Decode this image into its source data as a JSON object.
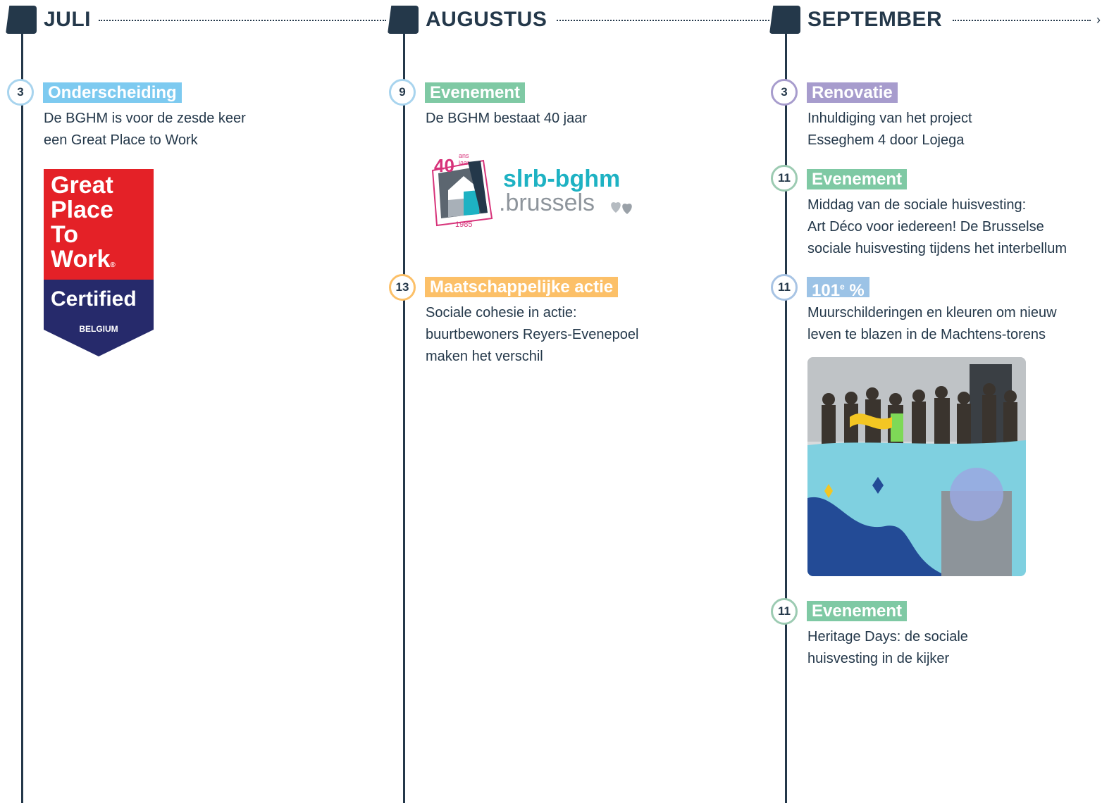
{
  "months": [
    {
      "name": "JULI",
      "events": [
        {
          "day": "3",
          "tag": "Onderscheiding",
          "lines": [
            "De BGHM is voor de zesde keer",
            "een Great Place to Work"
          ]
        }
      ],
      "badge": {
        "line1": "Great",
        "line2": "Place",
        "line3": "To",
        "line4": "Work",
        "reg": "®",
        "certified": "Certified",
        "country": "BELGIUM"
      }
    },
    {
      "name": "AUGUSTUS",
      "events": [
        {
          "day": "9",
          "tag": "Evenement",
          "lines": [
            "De BGHM bestaat 40 jaar"
          ]
        },
        {
          "day": "13",
          "tag": "Maatschappelijke actie",
          "lines": [
            "Sociale cohesie in actie:",
            "buurtbewoners Reyers-Evenepoel",
            "maken het verschil"
          ]
        }
      ],
      "logo": {
        "number": "40",
        "small_top": "ans",
        "small_bottom": "jaar",
        "year": "1985",
        "name_top": "slrb-bghm",
        "name_bottom": ".brussels"
      }
    },
    {
      "name": "SEPTEMBER",
      "events": [
        {
          "day": "3",
          "tag": "Renovatie",
          "lines": [
            "Inhuldiging van het project",
            "Esseghem 4 door Lojega"
          ]
        },
        {
          "day": "11",
          "tag": "Evenement",
          "lines": [
            "Middag van de sociale huisvesting:",
            "Art Déco voor iedereen! De Brusselse",
            "sociale huisvesting tijdens het interbellum"
          ]
        },
        {
          "day": "11",
          "tag_main": "101",
          "tag_sup": "e",
          "tag_pct": "%",
          "lines": [
            "Muurschilderingen en kleuren om nieuw",
            "leven te blazen in de Machtens-torens"
          ]
        },
        {
          "day": "11",
          "tag": "Evenement",
          "lines": [
            "Heritage Days: de sociale",
            "huisvesting in de kijker"
          ]
        }
      ]
    }
  ],
  "colors": {
    "navy": "#24384a",
    "blue": "#7dcaf0",
    "green": "#7fc9a4",
    "orange": "#fcc068",
    "purple": "#a79ccd",
    "light_blue": "#9cc3e6",
    "gpw_red": "#e42127",
    "gpw_navy": "#262a6b"
  }
}
